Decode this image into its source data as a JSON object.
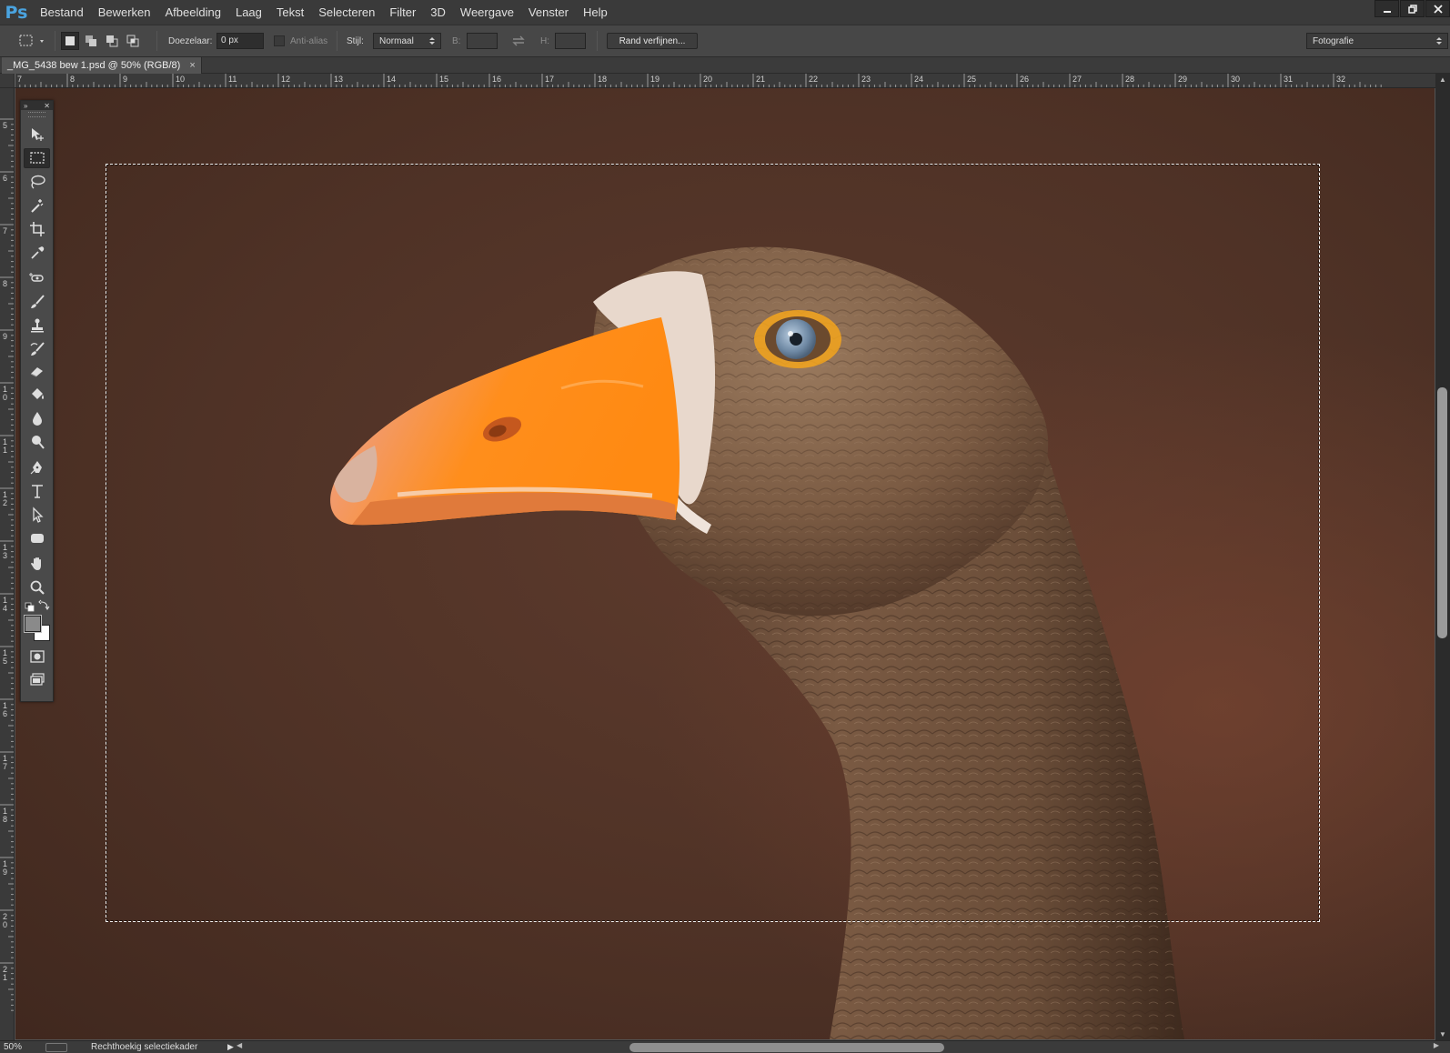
{
  "app": {
    "logo": "Ps",
    "menu": [
      "Bestand",
      "Bewerken",
      "Afbeelding",
      "Laag",
      "Tekst",
      "Selecteren",
      "Filter",
      "3D",
      "Weergave",
      "Venster",
      "Help"
    ],
    "window_controls": [
      "minimize-icon",
      "restore-icon",
      "close-icon"
    ]
  },
  "options": {
    "feather_label": "Doezelaar:",
    "feather_value": "0 px",
    "antialias_label": "Anti-alias",
    "style_label": "Stijl:",
    "style_value": "Normaal",
    "width_label": "B:",
    "height_label": "H:",
    "refine_edge_label": "Rand verfijnen...",
    "workspace_value": "Fotografie"
  },
  "document": {
    "tab_title": "_MG_5438 bew 1.psd @ 50% (RGB/8)",
    "tab_close": "×"
  },
  "rulers": {
    "horizontal": [
      "7",
      "8",
      "9",
      "10",
      "11",
      "12",
      "13",
      "14",
      "15",
      "16",
      "17",
      "18",
      "19",
      "20",
      "21",
      "22",
      "23",
      "24",
      "25",
      "26",
      "27",
      "28",
      "29",
      "30",
      "31",
      "32"
    ],
    "vertical": [
      "5",
      "6",
      "7",
      "8",
      "9",
      "10",
      "11",
      "12",
      "13",
      "14",
      "15",
      "16",
      "17",
      "18",
      "19",
      "20",
      "21"
    ]
  },
  "status": {
    "zoom": "50%",
    "text": "Rechthoekig selectiekader",
    "arrow": "▶"
  },
  "tools": [
    "move-tool-icon",
    "rectangular-marquee-tool-icon",
    "lasso-tool-icon",
    "magic-wand-tool-icon",
    "crop-tool-icon",
    "eyedropper-tool-icon",
    "spot-healing-brush-icon",
    "brush-tool-icon",
    "clone-stamp-icon",
    "history-brush-icon",
    "eraser-tool-icon",
    "paint-bucket-icon",
    "blur-tool-icon",
    "dodge-tool-icon",
    "pen-tool-icon",
    "type-tool-icon",
    "path-selection-icon",
    "rectangle-shape-icon",
    "hand-tool-icon",
    "zoom-tool-icon"
  ],
  "colors": {
    "foreground": "#8a8a8a",
    "background": "#ffffff",
    "accent": "#4aa3df"
  }
}
